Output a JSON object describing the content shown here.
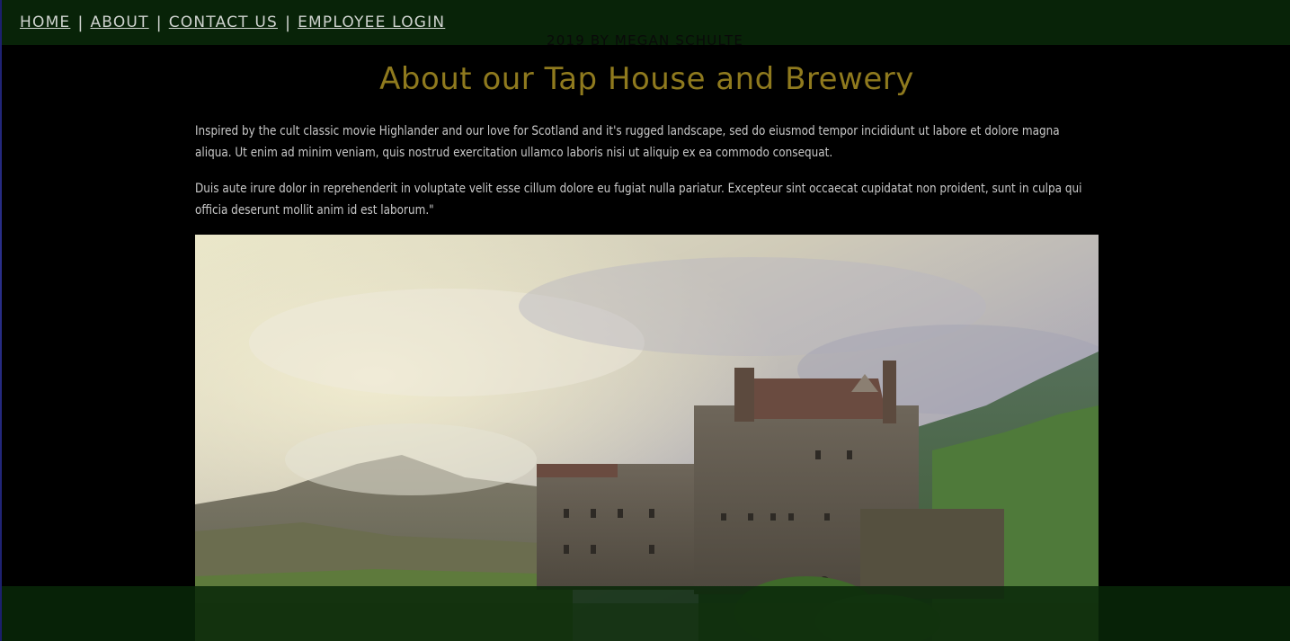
{
  "nav": {
    "items": [
      {
        "label": "HOME"
      },
      {
        "label": "ABOUT"
      },
      {
        "label": "CONTACT US"
      },
      {
        "label": "EMPLOYEE LOGIN"
      }
    ],
    "separator": "|"
  },
  "main": {
    "title": "About our Tap House and Brewery",
    "paragraphs": [
      "Inspired by the cult classic movie Highlander and our love for Scotland and it's rugged landscape, sed do eiusmod tempor incididunt ut labore et dolore magna aliqua. Ut enim ad minim veniam, quis nostrud exercitation ullamco laboris nisi ut aliquip ex ea commodo consequat.",
      "Duis aute irure dolor in reprehenderit in voluptate velit esse cillum dolore eu fugiat nulla pariatur. Excepteur sint occaecat cupidatat non proident, sunt in culpa qui officia deserunt mollit anim id est laborum.\""
    ]
  },
  "footer": {
    "text": "2019 BY MEGAN SCHULTE"
  },
  "colors": {
    "nav_bg": "#082308",
    "title": "#8f7a1e",
    "body_text": "#c8c8c8",
    "page_bg": "#000000"
  }
}
